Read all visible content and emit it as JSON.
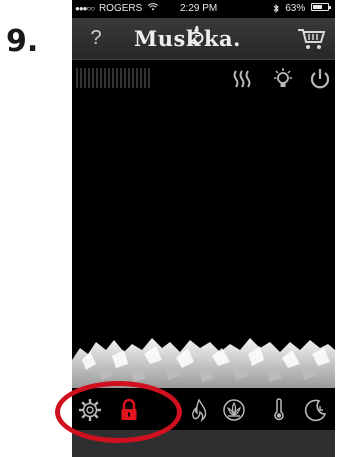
{
  "step_number": "9.",
  "status_bar": {
    "signal": "●●●○○",
    "carrier": "ROGERS",
    "time": "2:29 PM",
    "battery_percent": "63%",
    "battery_level": 0.63
  },
  "nav": {
    "help_label": "?",
    "brand": "Muskoka",
    "cart_icon": "cart-icon"
  },
  "controls": {
    "heat_icon": "heat-waves-icon",
    "light_icon": "light-bulb-icon",
    "power_icon": "power-icon"
  },
  "tabs": [
    {
      "name": "settings",
      "icon": "gear-icon"
    },
    {
      "name": "lock",
      "icon": "padlock-icon",
      "active": true
    },
    {
      "name": "flame",
      "icon": "flame-icon"
    },
    {
      "name": "ember",
      "icon": "ember-icon"
    },
    {
      "name": "temperature",
      "icon": "thermometer-icon"
    },
    {
      "name": "timer",
      "icon": "moon-timer-icon"
    }
  ],
  "colors": {
    "background": "#000000",
    "nav_bar": "#2e2e2e",
    "icon": "#b8b8b8",
    "active_tab": "#e0141e",
    "highlight_ring": "#d0101e"
  }
}
